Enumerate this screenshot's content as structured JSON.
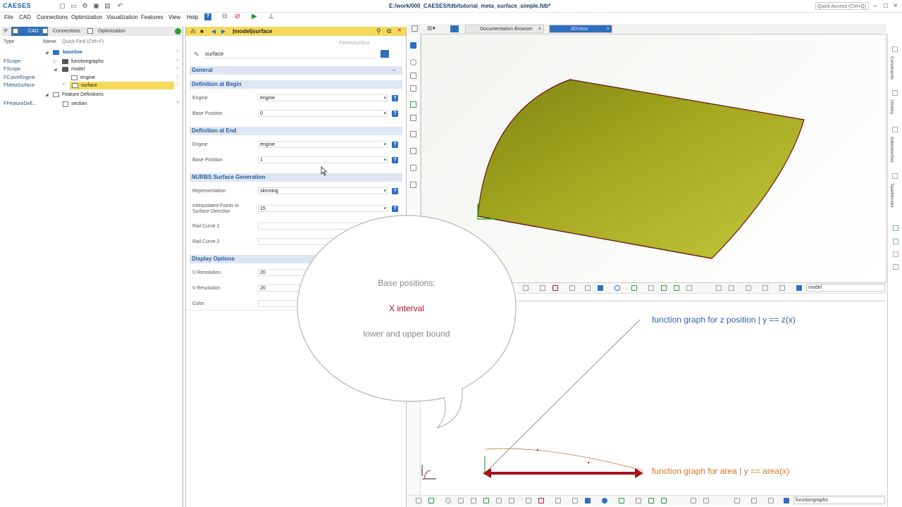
{
  "app": {
    "brand": "CAESES",
    "document_title": "E:/work/000_CAESES/fdb/tutorial_meta_surface_simple.fdb*",
    "quick_access_placeholder": "Quick Access (Ctrl+Q)"
  },
  "menu": [
    "File",
    "CAD",
    "Connections",
    "Optimization",
    "Visualization",
    "Features",
    "View",
    "Help"
  ],
  "left_panel": {
    "tabs": [
      "CAD",
      "Connections",
      "Optimization"
    ],
    "columns": {
      "type": "Type",
      "name": "Name",
      "find_placeholder": "Quick Find (Ctrl+F)"
    },
    "tree": [
      {
        "type": "",
        "name": "baseline"
      },
      {
        "type": "FScope",
        "name": "functiongraphs"
      },
      {
        "type": "FScope",
        "name": "model"
      },
      {
        "type": "FCurveEngine",
        "name": "engine"
      },
      {
        "type": "FMetaSurface",
        "name": "surface"
      },
      {
        "type": "",
        "name": "Feature Definitions"
      },
      {
        "type": "FFeatureDefi...",
        "name": "section"
      }
    ]
  },
  "editor": {
    "path": "|model|surface",
    "object_type": "FMetaSurface",
    "name": "surface",
    "sections": {
      "general": "General",
      "def_begin": "Definition at Begin",
      "def_end": "Definition at End",
      "nurbs": "NURBS Surface Generation",
      "display": "Display Options"
    },
    "fields": {
      "begin_engine": {
        "label": "Engine",
        "value": "engine"
      },
      "begin_base": {
        "label": "Base Position",
        "value": "0"
      },
      "end_engine": {
        "label": "Engine",
        "value": "engine"
      },
      "end_base": {
        "label": "Base Position",
        "value": "1"
      },
      "representation": {
        "label": "Representation",
        "value": "skinning"
      },
      "interp_points_1": "Interpolated Points in",
      "interp_points_2": "Surface Direction",
      "interp_points_value": "15",
      "rail1": {
        "label": "Rail Curve 1",
        "value": ""
      },
      "rail2": {
        "label": "Rail Curve 2",
        "value": ""
      },
      "u_res": {
        "label": "U Resolution",
        "value": "20"
      },
      "v_res": {
        "label": "V Resolution",
        "value": "20"
      },
      "color": {
        "label": "Color",
        "value": ""
      }
    }
  },
  "right_tabs": [
    "Documentation Browser",
    "3DView"
  ],
  "view3d": {
    "search_value": "model"
  },
  "view2d": {
    "search_value": "functiongraphs",
    "annotation_z": "function graph for z position | y == z(x)",
    "annotation_area": "function graph for area | y == area(x)"
  },
  "callout": {
    "line1": "Base positions:",
    "line2": "X interval",
    "line3": "lower and upper bound"
  },
  "sidebar_tabs": [
    "Constraints",
    "History",
    "SelectionSet",
    "TaskMonitor"
  ],
  "colors": {
    "accent": "#2f6fbd",
    "header_yellow": "#f5d95b",
    "surface": "#a5a820",
    "callout_red": "#b0102a",
    "arrow_red": "#a5121f"
  }
}
